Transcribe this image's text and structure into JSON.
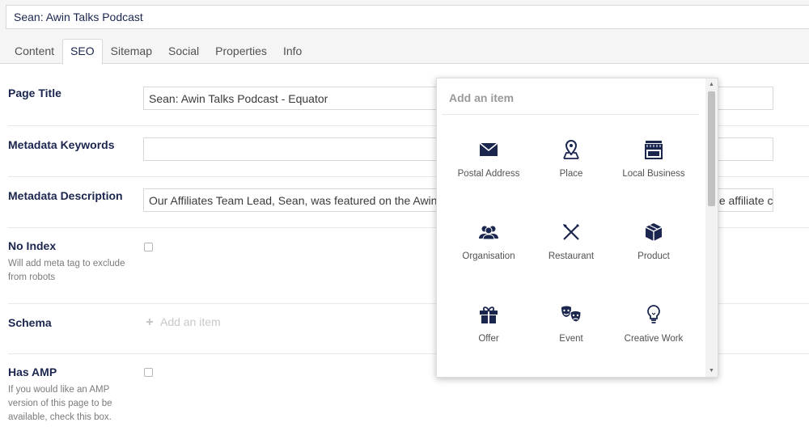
{
  "node_name": "Sean: Awin Talks Podcast",
  "tabs": [
    {
      "label": "Content"
    },
    {
      "label": "SEO"
    },
    {
      "label": "Sitemap"
    },
    {
      "label": "Social"
    },
    {
      "label": "Properties"
    },
    {
      "label": "Info"
    }
  ],
  "active_tab": "SEO",
  "fields": {
    "page_title": {
      "label": "Page Title",
      "value": "Sean: Awin Talks Podcast - Equator"
    },
    "metadata_keywords": {
      "label": "Metadata Keywords",
      "value": ""
    },
    "metadata_description": {
      "label": "Metadata Description",
      "value": "Our Affiliates Team Lead, Sean, was featured on the Awin Talks Podcast to discuss working with an agency and the affiliate channel, talking all things partnership marketing for the Awin"
    },
    "no_index": {
      "label": "No Index",
      "description": "Will add meta tag to exclude from robots",
      "checked": false
    },
    "schema": {
      "label": "Schema",
      "add_item_label": "Add an item"
    },
    "has_amp": {
      "label": "Has AMP",
      "description": "If you would like an AMP version of this page to be available, check this box.",
      "checked": false
    }
  },
  "dropdown": {
    "header": "Add an item",
    "items": [
      {
        "label": "Postal Address",
        "icon": "envelope-icon"
      },
      {
        "label": "Place",
        "icon": "map-pin-icon"
      },
      {
        "label": "Local Business",
        "icon": "store-icon"
      },
      {
        "label": "Organisation",
        "icon": "people-icon"
      },
      {
        "label": "Restaurant",
        "icon": "cutlery-icon"
      },
      {
        "label": "Product",
        "icon": "box-icon"
      },
      {
        "label": "Offer",
        "icon": "gift-icon"
      },
      {
        "label": "Event",
        "icon": "theater-masks-icon"
      },
      {
        "label": "Creative Work",
        "icon": "lightbulb-icon"
      }
    ]
  },
  "colors": {
    "text_dark": "#1b264f",
    "muted": "#7b7b7b",
    "border": "#d8d7d9",
    "panel_bg": "#f5f5f5"
  }
}
